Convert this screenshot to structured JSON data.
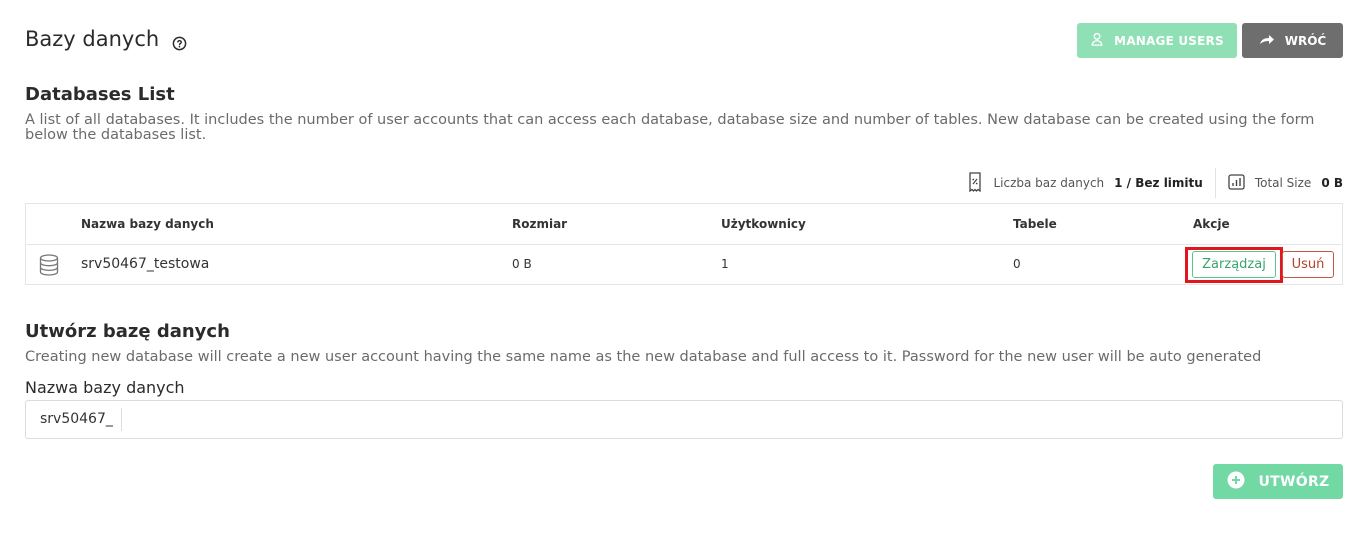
{
  "header": {
    "title": "Bazy danych",
    "manage_users_label": "MANAGE USERS",
    "back_label": "WRÓĆ"
  },
  "databases_list": {
    "title": "Databases List",
    "description": "A list of all databases. It includes the number of user accounts that can access each database, database size and number of tables. New database can be created using the form below the databases list."
  },
  "stats": {
    "count_label": "Liczba baz danych",
    "count_value": "1 / Bez limitu",
    "size_label": "Total Size",
    "size_value": "0 B"
  },
  "table": {
    "columns": [
      "Nazwa bazy danych",
      "Rozmiar",
      "Użytkownicy",
      "Tabele",
      "Akcje"
    ],
    "rows": [
      {
        "name": "srv50467_testowa",
        "size": "0 B",
        "users": "1",
        "tables": "0",
        "manage_label": "Zarządzaj",
        "delete_label": "Usuń"
      }
    ]
  },
  "create": {
    "title": "Utwórz bazę danych",
    "description": "Creating new database will create a new user account having the same name as the new database and full access to it. Password for the new user will be auto generated",
    "field_label": "Nazwa bazy danych",
    "prefix": "srv50467_",
    "value": "",
    "button_label": "UTWÓRZ"
  },
  "colors": {
    "accent_green": "#73d9a4",
    "danger": "#b0442a",
    "highlight": "#e1161e"
  }
}
